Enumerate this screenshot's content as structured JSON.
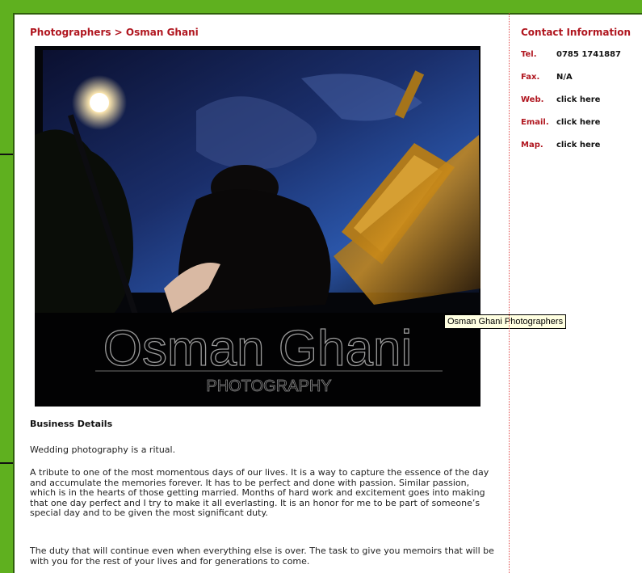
{
  "breadcrumb": "Photographers > Osman Ghani",
  "photo": {
    "watermark_name": "Osman Ghani",
    "watermark_sub": "PHOTOGRAPHY",
    "tooltip": "Osman Ghani Photographers"
  },
  "business": {
    "heading": "Business Details",
    "p1": "Wedding photography is a ritual.",
    "p2": "A tribute to one of the most momentous days of our lives. It is a way to capture the essence of the day and accumulate the memories forever. It has to be perfect and done with passion. Similar passion, which is in the hearts of those getting married. Months of hard work and excitement goes into making that one day perfect and I try to make it all everlasting. It is an honor for me to be part of someone’s special day and to be given the most significant duty.",
    "p3": "The duty that will continue even when everything else is over. The task to give you memoirs that will be with you for the rest of your lives and for generations to come."
  },
  "contact": {
    "title": "Contact Information",
    "tel_label": "Tel.",
    "tel_value": "0785 1741887",
    "fax_label": "Fax.",
    "fax_value": "N/A",
    "web_label": "Web.",
    "web_value": "click here",
    "email_label": "Email.",
    "email_value": "click here",
    "map_label": "Map.",
    "map_value": "click here"
  },
  "colors": {
    "frame_green": "#5fb01f",
    "accent_red": "#b0161f"
  }
}
